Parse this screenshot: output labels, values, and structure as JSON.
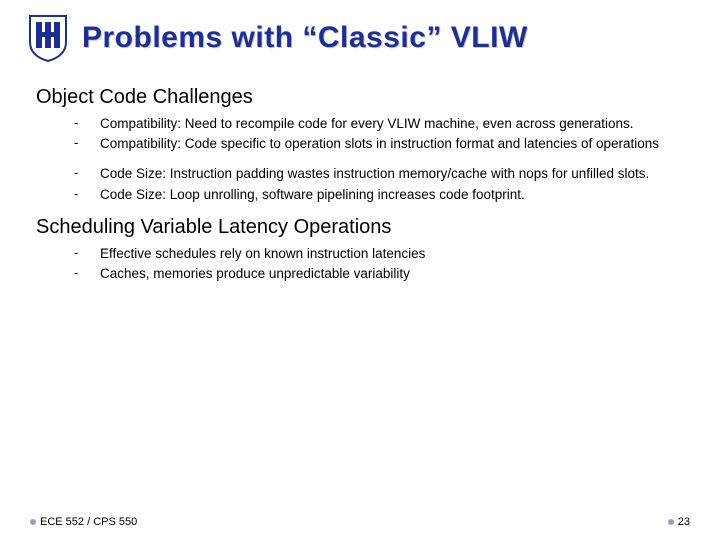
{
  "title": "Problems with “Classic” VLIW",
  "sections": [
    {
      "heading": "Object Code Challenges",
      "groups": [
        [
          "Compatibility: Need to recompile code for every VLIW machine, even across generations.",
          "Compatibility: Code specific to operation slots in instruction format and latencies of operations"
        ],
        [
          "Code Size: Instruction padding wastes instruction memory/cache with nops for unfilled slots.",
          "Code Size: Loop unrolling, software pipelining increases code footprint."
        ]
      ]
    },
    {
      "heading": "Scheduling Variable Latency Operations",
      "groups": [
        [
          "Effective schedules rely on known instruction latencies",
          "Caches, memories produce unpredictable variability"
        ]
      ]
    }
  ],
  "footer": {
    "left": "ECE 552 / CPS 550",
    "right": "23"
  },
  "logo_color": "#1f2f8f"
}
